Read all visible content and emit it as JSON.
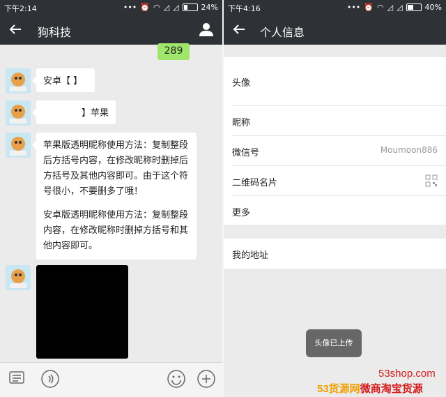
{
  "left": {
    "status": {
      "time": "下午2:14",
      "battery": "24%"
    },
    "header": {
      "title": "狗科技"
    },
    "messages": {
      "sent_number": "289",
      "m1": "安卓【    】",
      "m2": "】苹果",
      "m3_p1": "苹果版透明昵称使用方法：复制整段后方括号内容，在修改昵称时删掉后方括号及其他内容即可。由于这个符号很小，不要删多了哦！",
      "m3_p2": "安卓版透明昵称使用方法：复制整段内容，在修改昵称时删掉方括号和其他内容即可。"
    }
  },
  "right": {
    "status": {
      "time": "下午4:16",
      "battery": "40%"
    },
    "header": {
      "title": "个人信息"
    },
    "rows": {
      "avatar": "头像",
      "nickname": "昵称",
      "wechat_id_label": "微信号",
      "wechat_id_value": "Moumoon886",
      "qr": "二维码名片",
      "more": "更多",
      "address": "我的地址"
    },
    "toast": "头像已上传"
  },
  "watermark": {
    "site": "53shop.com",
    "brand_a": "53货源网",
    "brand_b": "微商淘宝货源"
  },
  "colors": {
    "bar": "#2e3135",
    "sent_bubble": "#9fe66b",
    "background": "#ebebeb"
  }
}
